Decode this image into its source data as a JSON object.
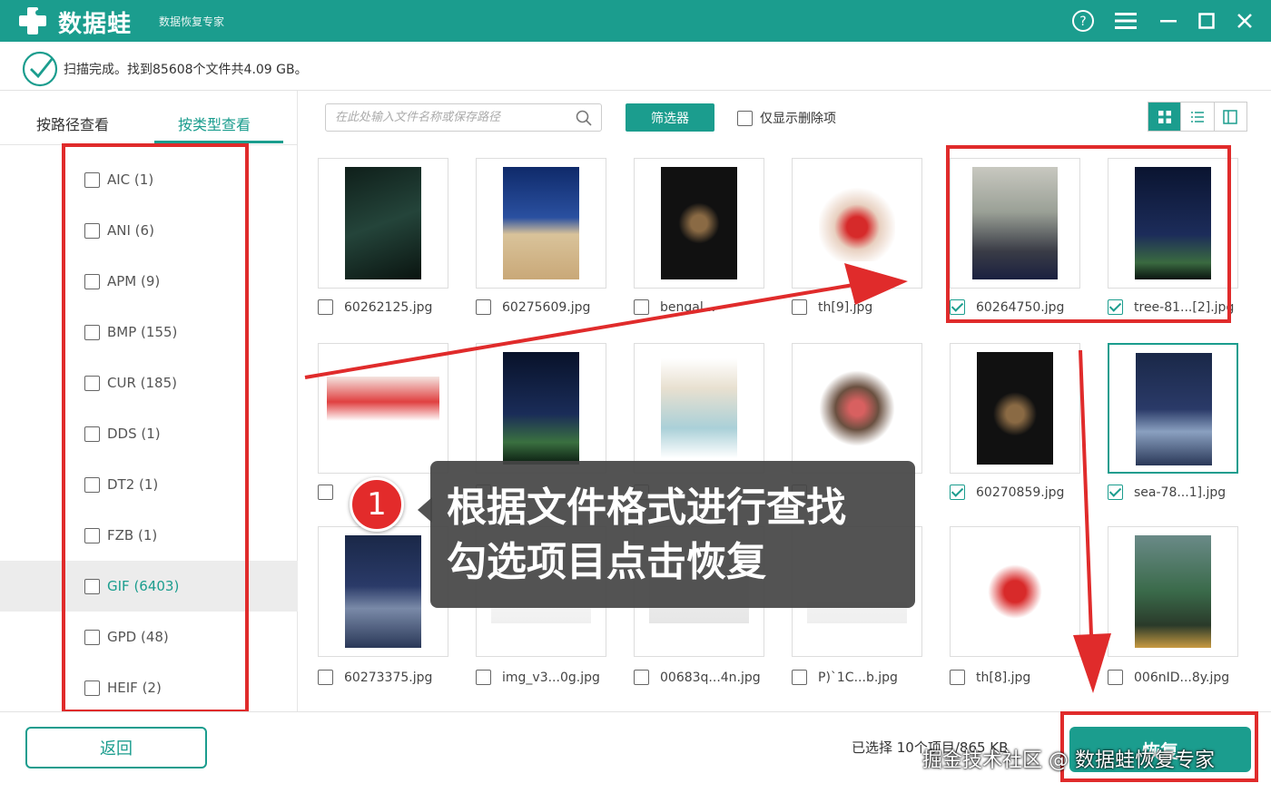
{
  "app": {
    "name": "数据蛙",
    "subtitle": "数据恢复专家"
  },
  "status": {
    "text": "扫描完成。找到85608个文件共4.09 GB。"
  },
  "tabs": [
    {
      "label": "按路径查看",
      "active": false
    },
    {
      "label": "按类型查看",
      "active": true
    }
  ],
  "types": [
    {
      "label": "AIC (1)",
      "selected": false
    },
    {
      "label": "ANI (6)",
      "selected": false
    },
    {
      "label": "APM (9)",
      "selected": false
    },
    {
      "label": "BMP (155)",
      "selected": false
    },
    {
      "label": "CUR (185)",
      "selected": false
    },
    {
      "label": "DDS (1)",
      "selected": false
    },
    {
      "label": "DT2 (1)",
      "selected": false
    },
    {
      "label": "FZB (1)",
      "selected": false
    },
    {
      "label": "GIF (6403)",
      "selected": true
    },
    {
      "label": "GPD (48)",
      "selected": false
    },
    {
      "label": "HEIF (2)",
      "selected": false
    }
  ],
  "toolbar": {
    "search_placeholder": "在此处输入文件名称或保存路径",
    "filter_label": "筛选器",
    "only_deleted_label": "仅显示删除项"
  },
  "files": [
    {
      "name": "60262125.jpg",
      "checked": false
    },
    {
      "name": "60275609.jpg",
      "checked": false
    },
    {
      "name": "bengal...",
      "checked": false
    },
    {
      "name": "th[9].jpg",
      "checked": false
    },
    {
      "name": "60264750.jpg",
      "checked": true
    },
    {
      "name": "tree-81...[2].jpg",
      "checked": true
    },
    {
      "name": "",
      "checked": false
    },
    {
      "name": "",
      "checked": false
    },
    {
      "name": "",
      "checked": false
    },
    {
      "name": "",
      "checked": false
    },
    {
      "name": "60270859.jpg",
      "checked": true
    },
    {
      "name": "sea-78...1].jpg",
      "checked": true
    },
    {
      "name": "60273375.jpg",
      "checked": false
    },
    {
      "name": "img_v3...0g.jpg",
      "checked": false
    },
    {
      "name": "00683q...4n.jpg",
      "checked": false
    },
    {
      "name": "P)`1C...b.jpg",
      "checked": false
    },
    {
      "name": "th[8].jpg",
      "checked": false
    },
    {
      "name": "006nID...8y.jpg",
      "checked": false
    }
  ],
  "footer": {
    "back_label": "返回",
    "selected_info": "已选择 10个项目/865 KB",
    "recover_label": "恢复"
  },
  "callout": {
    "number": "1",
    "line1": "根据文件格式进行查找",
    "line2": "勾选项目点击恢复"
  },
  "watermark": "掘金技术社区 @ 数据蛙恢复专家",
  "colors": {
    "brand": "#1b9d8e",
    "annotation": "#e02b2b"
  }
}
